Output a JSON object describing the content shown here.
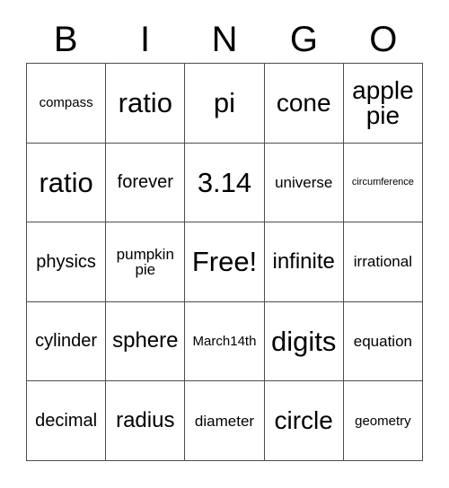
{
  "card": {
    "type": "bingo-card",
    "theme": "Pi Day",
    "grid_size": "5x5",
    "background_color": "#ffffff",
    "text_color": "#000000",
    "border_color": "#4d4d4d"
  },
  "header": {
    "letters": [
      "B",
      "I",
      "N",
      "G",
      "O"
    ]
  },
  "grid": {
    "columns": [
      "B",
      "I",
      "N",
      "G",
      "O"
    ],
    "rows": [
      {
        "cells": [
          {
            "text": "compass",
            "size": "fs-xs",
            "free": false,
            "stacked": false
          },
          {
            "text": "ratio",
            "size": "fs-xxl",
            "free": false,
            "stacked": false
          },
          {
            "text": "pi",
            "size": "fs-xxl",
            "free": false,
            "stacked": false
          },
          {
            "text": "cone",
            "size": "fs-xl",
            "free": false,
            "stacked": false
          },
          {
            "text": "apple pie",
            "size": "fs-xl",
            "free": false,
            "stacked": true
          }
        ]
      },
      {
        "cells": [
          {
            "text": "ratio",
            "size": "fs-xxl",
            "free": false,
            "stacked": false
          },
          {
            "text": "forever",
            "size": "fs-m",
            "free": false,
            "stacked": false
          },
          {
            "text": "3.14",
            "size": "fs-xxl",
            "free": false,
            "stacked": false
          },
          {
            "text": "universe",
            "size": "fs-s",
            "free": false,
            "stacked": false
          },
          {
            "text": "circumference",
            "size": "fs-xxs",
            "free": false,
            "stacked": false
          }
        ]
      },
      {
        "cells": [
          {
            "text": "physics",
            "size": "fs-m",
            "free": false,
            "stacked": false
          },
          {
            "text": "pumpkin pie",
            "size": "fs-s",
            "free": false,
            "stacked": true
          },
          {
            "text": "Free!",
            "size": "fs-xxl",
            "free": true,
            "stacked": false
          },
          {
            "text": "infinite",
            "size": "fs-l",
            "free": false,
            "stacked": false
          },
          {
            "text": "irrational",
            "size": "fs-s",
            "free": false,
            "stacked": false
          }
        ]
      },
      {
        "cells": [
          {
            "text": "cylinder",
            "size": "fs-m",
            "free": false,
            "stacked": false
          },
          {
            "text": "sphere",
            "size": "fs-l",
            "free": false,
            "stacked": false
          },
          {
            "text": "March14th",
            "size": "fs-xs",
            "free": false,
            "stacked": false
          },
          {
            "text": "digits",
            "size": "fs-xxl",
            "free": false,
            "stacked": false
          },
          {
            "text": "equation",
            "size": "fs-s",
            "free": false,
            "stacked": false
          }
        ]
      },
      {
        "cells": [
          {
            "text": "decimal",
            "size": "fs-m",
            "free": false,
            "stacked": false
          },
          {
            "text": "radius",
            "size": "fs-l",
            "free": false,
            "stacked": false
          },
          {
            "text": "diameter",
            "size": "fs-s",
            "free": false,
            "stacked": false
          },
          {
            "text": "circle",
            "size": "fs-xl",
            "free": false,
            "stacked": false
          },
          {
            "text": "geometry",
            "size": "fs-xs",
            "free": false,
            "stacked": false
          }
        ]
      }
    ]
  }
}
